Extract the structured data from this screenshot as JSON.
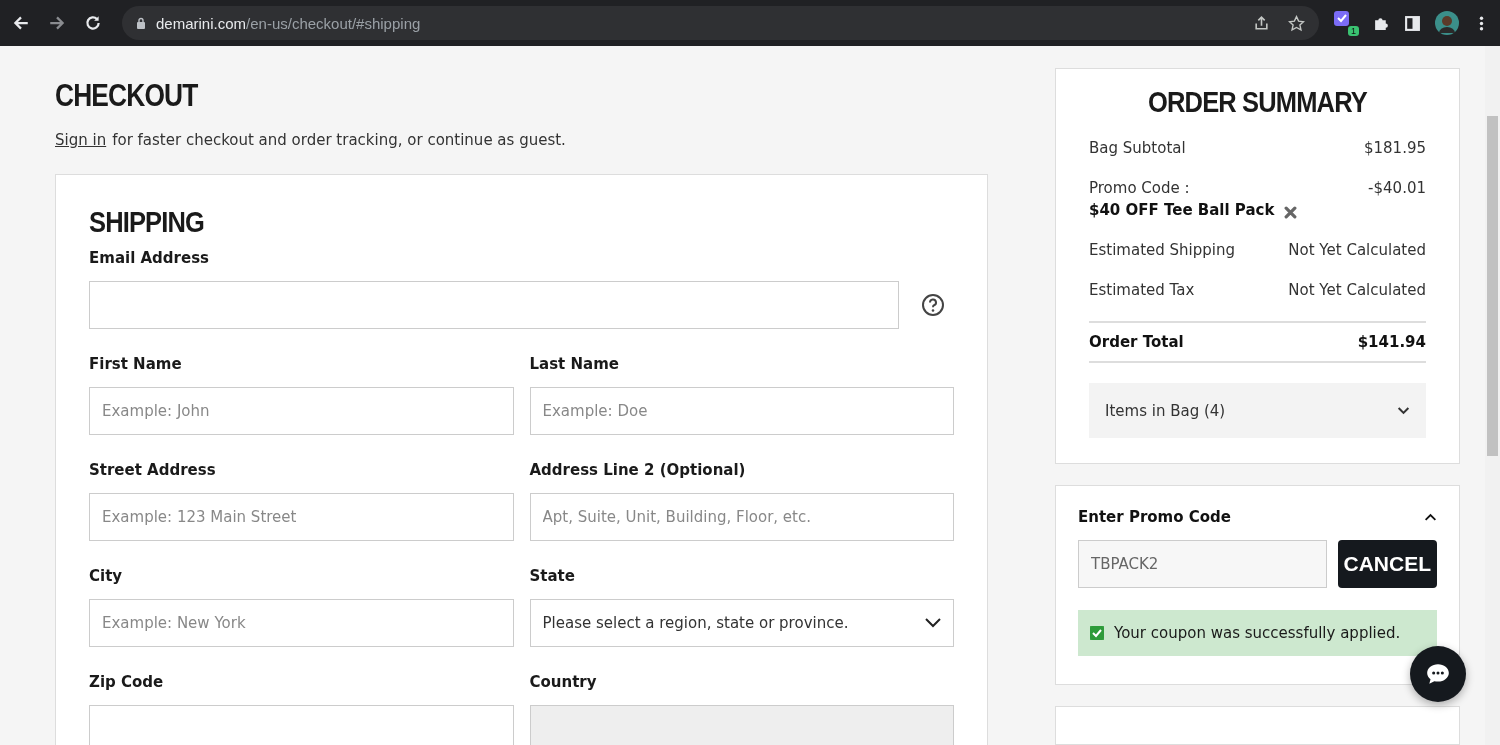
{
  "browser": {
    "url_host": "demarini.com",
    "url_path": "/en-us/checkout/#shipping",
    "extension_badge": "1"
  },
  "checkout": {
    "title": "CHECKOUT",
    "sign_in_link": "Sign in",
    "sign_in_text": "for faster checkout and order tracking, or continue as guest."
  },
  "shipping": {
    "title": "SHIPPING",
    "email": {
      "label": "Email Address"
    },
    "rows": [
      [
        {
          "label": "First Name",
          "placeholder": "Example: John",
          "kind": "text"
        },
        {
          "label": "Last Name",
          "placeholder": "Example: Doe",
          "kind": "text"
        }
      ],
      [
        {
          "label": "Street Address",
          "placeholder": "Example: 123 Main Street",
          "kind": "text"
        },
        {
          "label": "Address Line 2 (Optional)",
          "placeholder": "Apt, Suite, Unit, Building, Floor, etc.",
          "kind": "text"
        }
      ],
      [
        {
          "label": "City",
          "placeholder": "Example: New York",
          "kind": "text"
        },
        {
          "label": "State",
          "value": "Please select a region, state or province.",
          "kind": "select"
        }
      ],
      [
        {
          "label": "Zip Code",
          "kind": "text"
        },
        {
          "label": "Country",
          "kind": "locked"
        }
      ]
    ]
  },
  "summary": {
    "title": "ORDER SUMMARY",
    "lines": [
      {
        "label": "Bag Subtotal",
        "value": "$181.95",
        "kind": "plain"
      },
      {
        "label": "Promo Code :",
        "detail": "$40 OFF Tee Ball Pack",
        "value": "-$40.01",
        "kind": "promo"
      },
      {
        "label": "Estimated Shipping",
        "value": "Not Yet Calculated",
        "kind": "plain"
      },
      {
        "label": "Estimated Tax",
        "value": "Not Yet Calculated",
        "kind": "plain"
      },
      {
        "label": "Order Total",
        "value": "$141.94",
        "kind": "total"
      }
    ],
    "items_toggle": {
      "label": "Items in Bag (4)",
      "expanded": false
    }
  },
  "promo": {
    "title": "Enter Promo Code",
    "expanded": true,
    "value": "TBPACK2",
    "button": "CANCEL",
    "message": "Your coupon was successfully applied.",
    "checked": true
  }
}
